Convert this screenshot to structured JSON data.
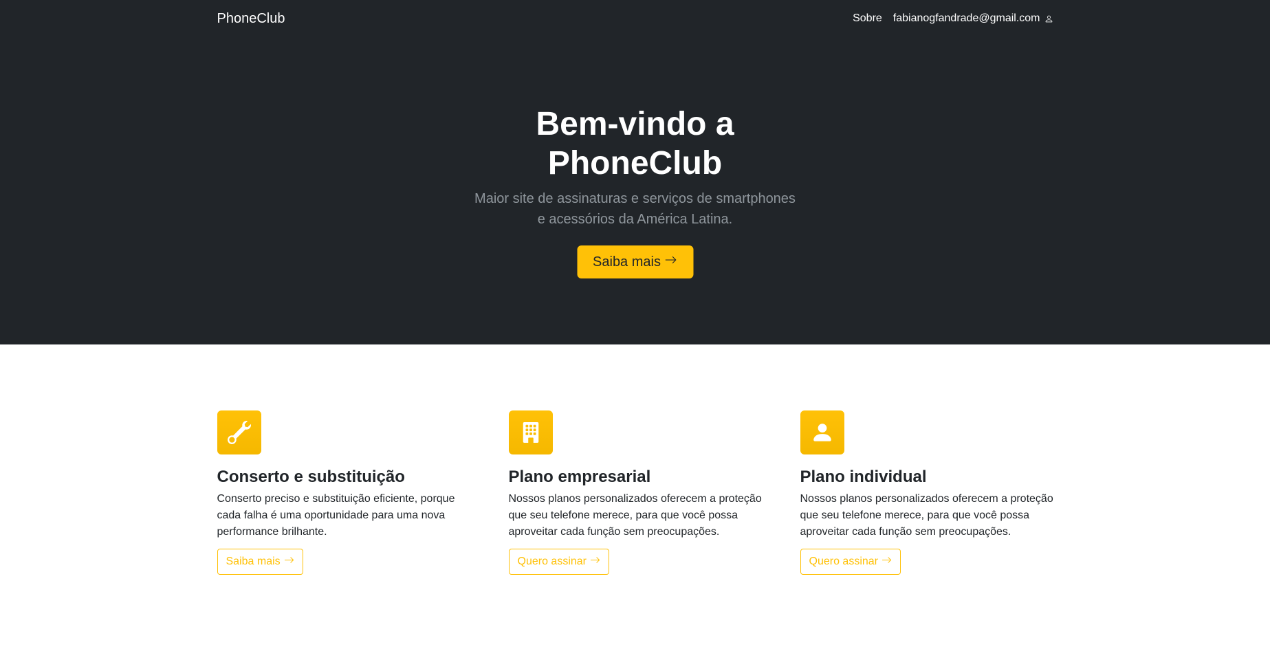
{
  "nav": {
    "brand": "PhoneClub",
    "about": "Sobre",
    "user_email": "fabianogfandrade@gmail.com",
    "user_icon": "person-icon"
  },
  "hero": {
    "title_line1": "Bem-vindo a",
    "title_line2": "PhoneClub",
    "lead": "Maior site de assinaturas e serviços de smartphones e acessórios da América Latina.",
    "cta_label": "Saiba mais"
  },
  "features": [
    {
      "icon": "wrench-icon",
      "title": "Conserto e substituição",
      "text": "Conserto preciso e substituição eficiente, porque cada falha é uma oportunidade para uma nova performance brilhante.",
      "button": "Saiba mais"
    },
    {
      "icon": "building-icon",
      "title": "Plano empresarial",
      "text": "Nossos planos personalizados oferecem a proteção que seu telefone merece, para que você possa aproveitar cada função sem preocupações.",
      "button": "Quero assinar"
    },
    {
      "icon": "person-fill-icon",
      "title": "Plano individual",
      "text": "Nossos planos personalizados oferecem a proteção que seu telefone merece, para que você possa aproveitar cada função sem preocupações.",
      "button": "Quero assinar"
    }
  ],
  "colors": {
    "dark": "#212529",
    "accent": "#ffc107",
    "muted": "#8f969c"
  }
}
